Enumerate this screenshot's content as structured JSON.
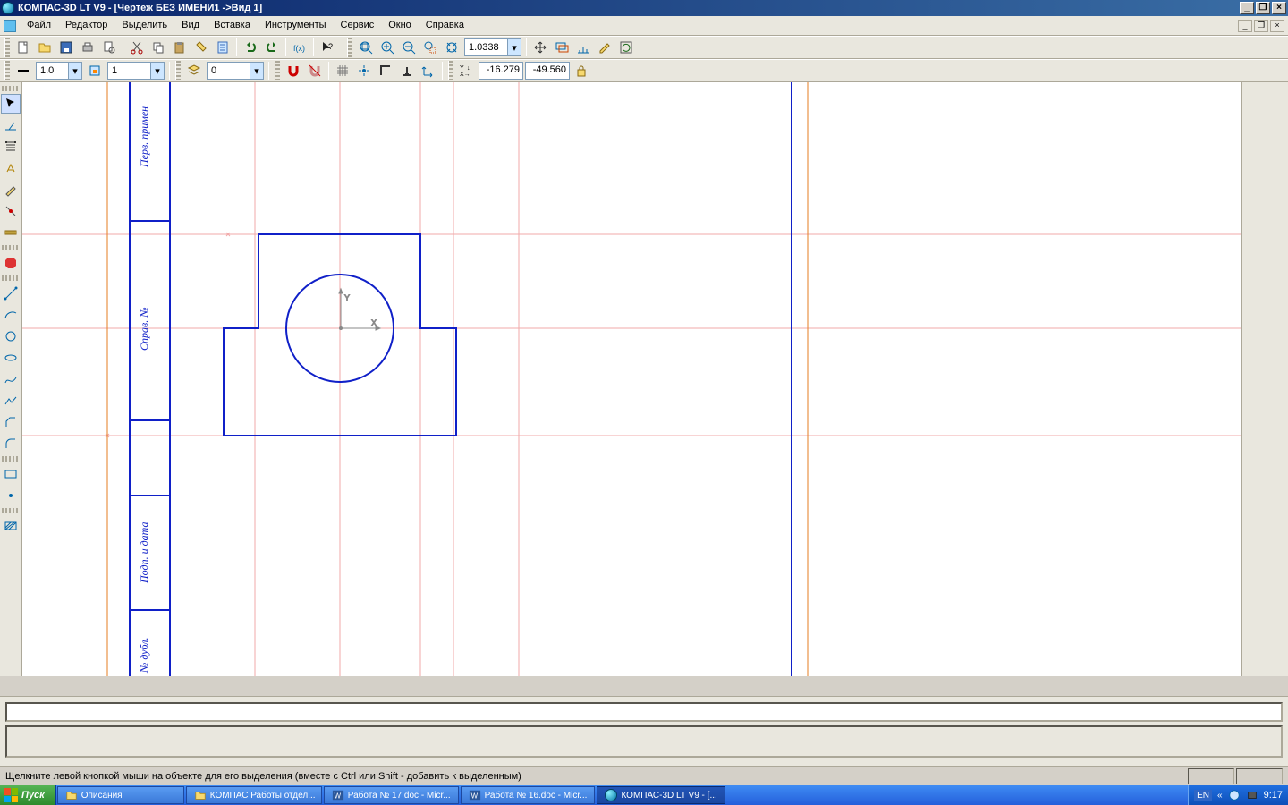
{
  "title": "КОМПАС-3D LT V9 - [Чертеж БЕЗ ИМЕНИ1 ->Вид 1]",
  "menu": {
    "file": "Файл",
    "edit": "Редактор",
    "select": "Выделить",
    "view": "Вид",
    "insert": "Вставка",
    "tools": "Инструменты",
    "service": "Сервис",
    "window": "Окно",
    "help": "Справка"
  },
  "toolbar2": {
    "line_weight": "1.0",
    "layer_num": "1",
    "layer2_num": "0"
  },
  "zoom": "1.0338",
  "coords": {
    "x": "-16.279",
    "y": "-49.560"
  },
  "axis": {
    "x": "X",
    "y": "Y"
  },
  "frame_labels": {
    "top": "Перв. примен",
    "mid": "Справ. №",
    "bot1": "Подп. и дата",
    "bot2": "№ дубл."
  },
  "status_msg": "Щелкните левой кнопкой мыши на объекте для его выделения (вместе с Ctrl или Shift - добавить к выделенным)",
  "taskbar": {
    "start": "Пуск",
    "items": [
      "Описания",
      "КОМПАС Работы отдел...",
      "Работа № 17.doc - Micr...",
      "Работа № 16.doc - Micr...",
      "КОМПАС-3D LT V9 - [..."
    ],
    "lang": "EN",
    "time": "9:17"
  }
}
